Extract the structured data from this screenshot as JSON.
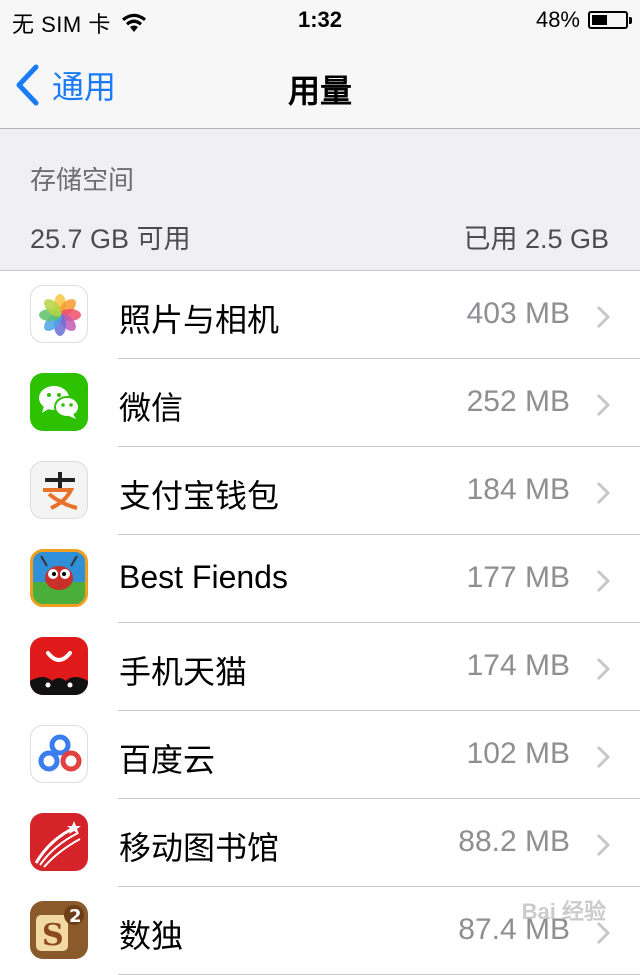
{
  "status_bar": {
    "carrier": "无 SIM 卡",
    "time": "1:32",
    "battery_percent_text": "48%",
    "battery_level": 0.48
  },
  "nav": {
    "back_label": "通用",
    "title": "用量"
  },
  "storage": {
    "header": "存储空间",
    "available": "25.7 GB 可用",
    "used": "已用 2.5 GB"
  },
  "apps": [
    {
      "name": "照片与相机",
      "size": "403 MB",
      "icon": "photos-icon"
    },
    {
      "name": "微信",
      "size": "252 MB",
      "icon": "wechat-icon"
    },
    {
      "name": "支付宝钱包",
      "size": "184 MB",
      "icon": "alipay-icon"
    },
    {
      "name": "Best Fiends",
      "size": "177 MB",
      "icon": "best-fiends-icon"
    },
    {
      "name": "手机天猫",
      "size": "174 MB",
      "icon": "tmall-icon"
    },
    {
      "name": "百度云",
      "size": "102 MB",
      "icon": "baidu-cloud-icon"
    },
    {
      "name": "移动图书馆",
      "size": "88.2 MB",
      "icon": "mobile-library-icon"
    },
    {
      "name": "数独",
      "size": "87.4 MB",
      "icon": "sudoku-icon"
    }
  ],
  "colors": {
    "accent": "#1a7cf5",
    "secondary_text": "#8e8e93",
    "section_bg": "#efeff4"
  },
  "watermark": "Bai 经验"
}
